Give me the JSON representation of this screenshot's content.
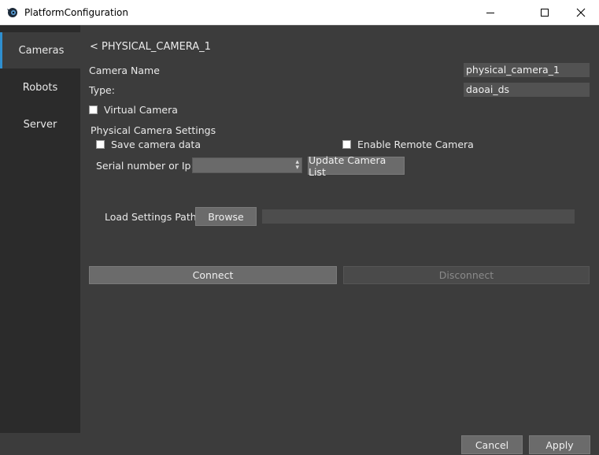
{
  "window": {
    "title": "PlatformConfiguration",
    "icon": "eye-logo-icon"
  },
  "sidebar": {
    "items": [
      {
        "label": "Cameras",
        "active": true
      },
      {
        "label": "Robots",
        "active": false
      },
      {
        "label": "Server",
        "active": false
      }
    ]
  },
  "camera": {
    "back_label": "< PHYSICAL_CAMERA_1",
    "name_label": "Camera Name",
    "name_value": "physical_camera_1",
    "type_label": "Type:",
    "type_value": "daoai_ds",
    "virtual_label": "Virtual Camera",
    "virtual_checked": false
  },
  "physical_settings": {
    "heading": "Physical Camera Settings",
    "save_data_label": "Save camera data",
    "save_data_checked": false,
    "remote_label": "Enable Remote Camera",
    "remote_checked": false,
    "serial_label": "Serial number or Ip:",
    "serial_value": "",
    "update_button": "Update Camera List"
  },
  "load_settings": {
    "label": "Load Settings Path",
    "browse_button": "Browse",
    "path_value": ""
  },
  "actions": {
    "connect": "Connect",
    "disconnect": "Disconnect",
    "cancel": "Cancel",
    "apply": "Apply"
  },
  "colors": {
    "accent": "#2f8fd0",
    "background": "#3c3c3c",
    "sidebar": "#2b2b2b"
  }
}
